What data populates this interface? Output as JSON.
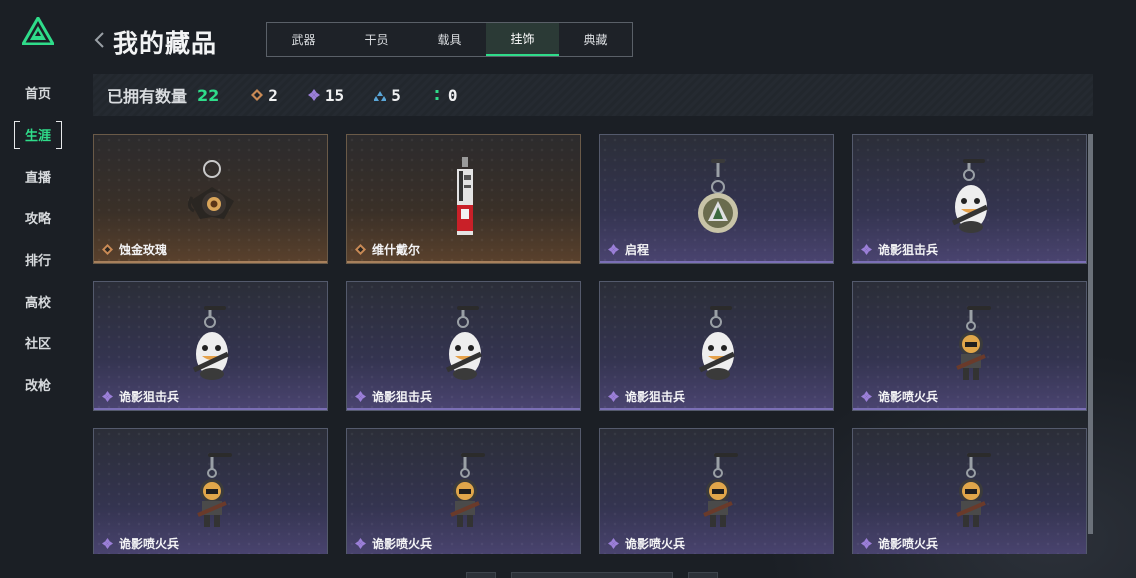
{
  "sidebar": {
    "items": [
      {
        "label": "首页"
      },
      {
        "label": "生涯"
      },
      {
        "label": "直播"
      },
      {
        "label": "攻略"
      },
      {
        "label": "排行"
      },
      {
        "label": "高校"
      },
      {
        "label": "社区"
      },
      {
        "label": "改枪"
      }
    ],
    "active_index": 1
  },
  "header": {
    "title": "我的藏品",
    "tabs": [
      {
        "label": "武器"
      },
      {
        "label": "干员"
      },
      {
        "label": "载具"
      },
      {
        "label": "挂饰"
      },
      {
        "label": "典藏"
      }
    ],
    "active_tab": 3
  },
  "stats": {
    "label": "已拥有数量",
    "total": "22",
    "counts": [
      {
        "icon": "gold-diamond-icon",
        "value": "2",
        "color": "#c98a55"
      },
      {
        "icon": "purple-diamond-icon",
        "value": "15",
        "color": "#9b7fd8"
      },
      {
        "icon": "blue-triangle-icon",
        "value": "5",
        "color": "#5aa6d8"
      },
      {
        "icon": "green-dots-icon",
        "value": "0",
        "color": "#2fdc8a"
      }
    ]
  },
  "items": [
    {
      "name": "蚀金玫瑰",
      "rarity": "gold",
      "art": "rose"
    },
    {
      "name": "维什戴尔",
      "rarity": "gold",
      "art": "tag"
    },
    {
      "name": "启程",
      "rarity": "purple",
      "art": "ring"
    },
    {
      "name": "诡影狙击兵",
      "rarity": "purple",
      "art": "sniper"
    },
    {
      "name": "诡影狙击兵",
      "rarity": "purple",
      "art": "sniper"
    },
    {
      "name": "诡影狙击兵",
      "rarity": "purple",
      "art": "sniper"
    },
    {
      "name": "诡影狙击兵",
      "rarity": "purple",
      "art": "sniper"
    },
    {
      "name": "诡影喷火兵",
      "rarity": "purple",
      "art": "flamer"
    },
    {
      "name": "诡影喷火兵",
      "rarity": "purple",
      "art": "flamer"
    },
    {
      "name": "诡影喷火兵",
      "rarity": "purple",
      "art": "flamer"
    },
    {
      "name": "诡影喷火兵",
      "rarity": "purple",
      "art": "flamer"
    },
    {
      "name": "诡影喷火兵",
      "rarity": "purple",
      "art": "flamer"
    }
  ],
  "colors": {
    "accent": "#2fdc8a",
    "gold": "#c98a55",
    "purple": "#9b7fd8"
  }
}
